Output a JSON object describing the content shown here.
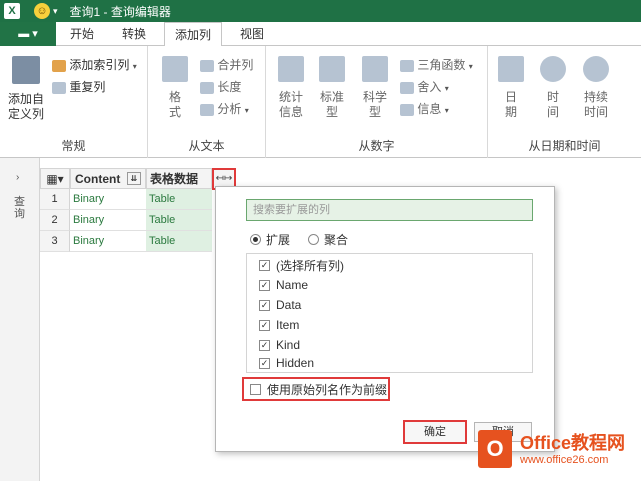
{
  "window": {
    "app_letter": "X",
    "title": "查询1 - 查询编辑器"
  },
  "tabs": {
    "file": "▬ ▾",
    "items": [
      "开始",
      "转换",
      "添加列",
      "视图"
    ]
  },
  "ribbon": {
    "general": {
      "custom_col": "添加自\n定义列",
      "index_col": "添加索引列",
      "dup_col": "重复列",
      "label": "常规"
    },
    "text": {
      "format": "格\n式",
      "merge": "合并列",
      "length": "长度",
      "analyze": "分析",
      "label": "从文本"
    },
    "number": {
      "stats": "统计\n信息",
      "standard": "标准\n型",
      "scientific": "科学\n型",
      "trig": "三角函数",
      "round": "舍入",
      "info": "信息",
      "label": "从数字"
    },
    "datetime": {
      "date": "日\n期",
      "time": "时\n间",
      "duration": "持续\n时间",
      "label": "从日期和时间"
    }
  },
  "leftnav": {
    "label": "查询"
  },
  "grid": {
    "headers": [
      "Content",
      "表格数据"
    ],
    "rows": [
      {
        "num": "1",
        "content": "Binary",
        "table": "Table"
      },
      {
        "num": "2",
        "content": "Binary",
        "table": "Table"
      },
      {
        "num": "3",
        "content": "Binary",
        "table": "Table"
      }
    ]
  },
  "popup": {
    "search_placeholder": "搜索要扩展的列",
    "mode": {
      "expand": "扩展",
      "aggregate": "聚合"
    },
    "columns": [
      "(选择所有列)",
      "Name",
      "Data",
      "Item",
      "Kind",
      "Hidden"
    ],
    "prefix_label": "使用原始列名作为前缀",
    "ok": "确定",
    "cancel": "取消"
  },
  "watermark": {
    "brand": "Office教程网",
    "url": "www.office26.com"
  }
}
